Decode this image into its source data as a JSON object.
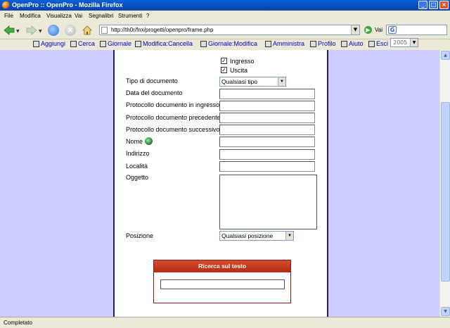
{
  "window": {
    "title": "OpenPro :: OpenPro - Mozilla Firefox"
  },
  "menu": [
    "File",
    "Modifica",
    "Visualizza",
    "Vai",
    "Segnalibri",
    "Strumenti",
    "?"
  ],
  "nav": {
    "url": "http://th0r/fnx/progetti/openpro/frame.php",
    "go_label": "Vai"
  },
  "app_toolbar": {
    "items": [
      "Aggiungi",
      "Cerca",
      "Giornale",
      "Modifica:Cancella",
      "Giornale:Modifica",
      "Amministra",
      "Profilo",
      "Aiuto",
      "Esci"
    ],
    "year": "2005"
  },
  "form": {
    "checkboxes": [
      {
        "label": "Ingresso",
        "checked": true
      },
      {
        "label": "Uscita",
        "checked": true
      }
    ],
    "tipo_label": "Tipo di documento",
    "tipo_value": "Qualsiasi tipo",
    "fields": [
      "Data del documento",
      "Protocollo documento in ingresso",
      "Protocollo documento precedente",
      "Protocollo documento successivo",
      "Nome",
      "Indirizzo",
      "Località",
      "Oggetto"
    ],
    "posizione_label": "Posizione",
    "posizione_value": "Qualsiasi posizione",
    "ricerca_title": "Ricerca sul testo"
  },
  "status": "Completato"
}
